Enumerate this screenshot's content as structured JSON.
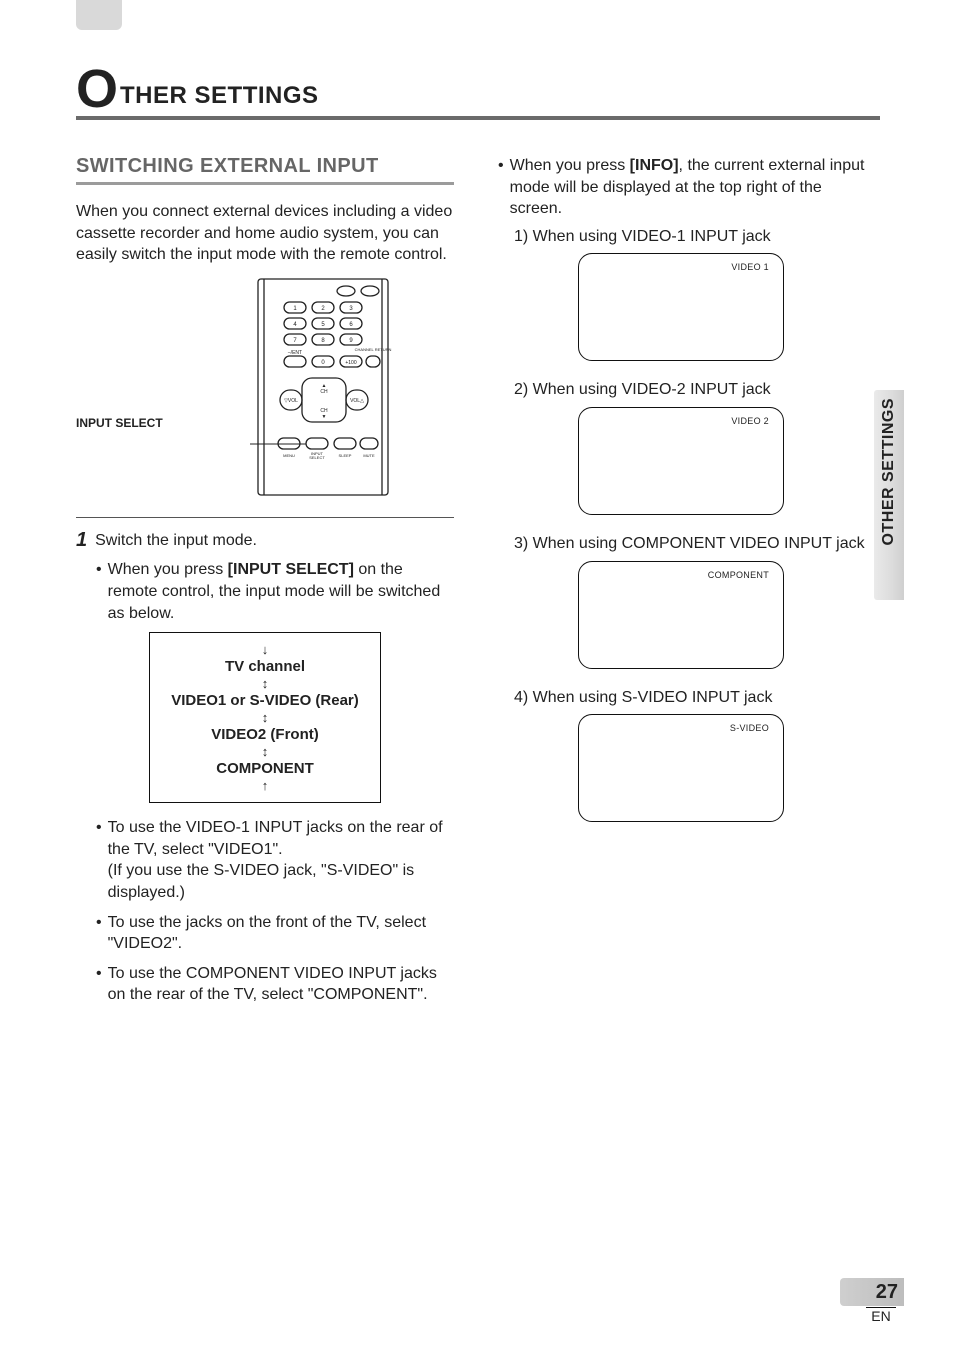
{
  "heading": {
    "bigLetter": "O",
    "rest": "THER SETTINGS"
  },
  "section_title": "SWITCHING EXTERNAL INPUT",
  "intro": "When you connect external devices including a video cassette recorder and home audio system, you can easily switch the input mode with the remote control.",
  "remote_label": "INPUT SELECT",
  "remote": {
    "keys": [
      "1",
      "2",
      "3",
      "4",
      "5",
      "6",
      "7",
      "8",
      "9",
      "0",
      "+100"
    ],
    "labels": {
      "ent": "–/ENT",
      "chret": "CHANNEL RETURN",
      "ch": "CH",
      "vol": "VOL",
      "menu": "MENU",
      "inputsel": "INPUT SELECT",
      "sleep": "SLEEP",
      "mute": "MUTE"
    }
  },
  "step1": {
    "num": "1",
    "title": "Switch the input mode.",
    "bullet1a": "When you press ",
    "bullet1b": "[INPUT SELECT]",
    "bullet1c": " on the remote control, the input mode will be switched as below."
  },
  "cycle": {
    "l1": "TV channel",
    "l2": "VIDEO1 or S-VIDEO (Rear)",
    "l3": "VIDEO2 (Front)",
    "l4": "COMPONENT"
  },
  "left_bullets": [
    "To use the VIDEO-1 INPUT jacks on the rear of the TV, select \"VIDEO1\".\n(If you use the S-VIDEO jack, \"S-VIDEO\" is displayed.)",
    "To use the jacks on the front of the TV, select \"VIDEO2\".",
    "To use the COMPONENT VIDEO INPUT jacks on the rear of the TV, select \"COMPONENT\"."
  ],
  "right": {
    "top_a": "When you press ",
    "top_b": "[INFO]",
    "top_c": ", the current external input mode will be displayed at the top right of the screen.",
    "items": [
      {
        "label": "1) When using VIDEO-1 INPUT jack",
        "osd": "VIDEO 1"
      },
      {
        "label": "2) When using VIDEO-2 INPUT jack",
        "osd": "VIDEO 2"
      },
      {
        "label": "3) When using COMPONENT VIDEO INPUT jack",
        "osd": "COMPONENT"
      },
      {
        "label": "4) When using S-VIDEO INPUT jack",
        "osd": "S-VIDEO"
      }
    ]
  },
  "side_tab": "OTHER SETTINGS",
  "page_number": "27",
  "lang": "EN"
}
